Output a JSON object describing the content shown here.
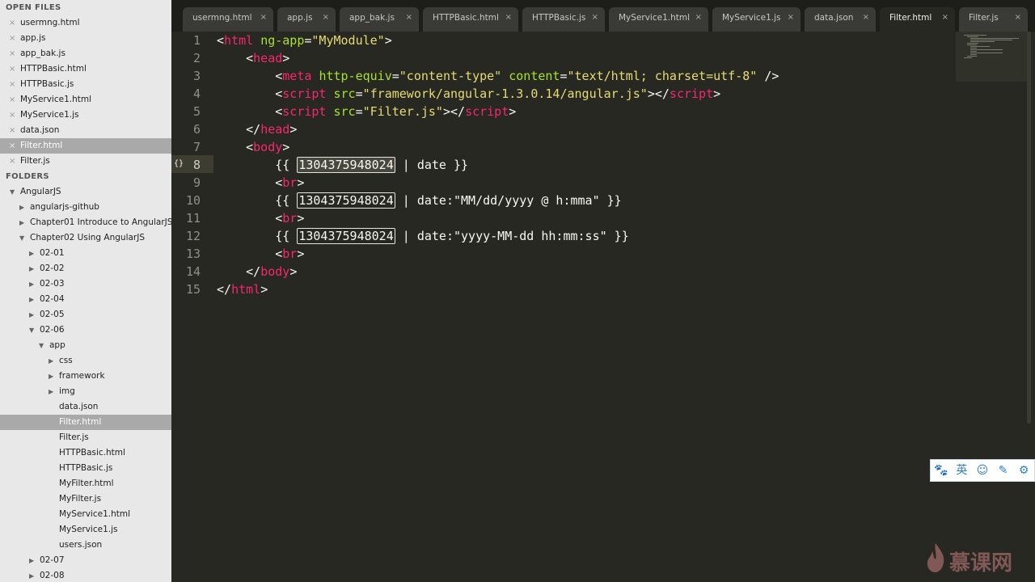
{
  "sidebar": {
    "open_files_header": "OPEN FILES",
    "open_files": [
      {
        "label": "usermng.html",
        "selected": false
      },
      {
        "label": "app.js",
        "selected": false
      },
      {
        "label": "app_bak.js",
        "selected": false
      },
      {
        "label": "HTTPBasic.html",
        "selected": false
      },
      {
        "label": "HTTPBasic.js",
        "selected": false
      },
      {
        "label": "MyService1.html",
        "selected": false
      },
      {
        "label": "MyService1.js",
        "selected": false
      },
      {
        "label": "data.json",
        "selected": false
      },
      {
        "label": "Filter.html",
        "selected": true
      },
      {
        "label": "Filter.js",
        "selected": false
      }
    ],
    "folders_header": "FOLDERS",
    "tree": [
      {
        "label": "AngularJS",
        "depth": 0,
        "type": "folder",
        "open": true
      },
      {
        "label": "angularjs-github",
        "depth": 1,
        "type": "folder",
        "open": false
      },
      {
        "label": "Chapter01 Introduce to AngularJS",
        "depth": 1,
        "type": "folder",
        "open": false
      },
      {
        "label": "Chapter02 Using AngularJS",
        "depth": 1,
        "type": "folder",
        "open": true
      },
      {
        "label": "02-01",
        "depth": 2,
        "type": "folder",
        "open": false
      },
      {
        "label": "02-02",
        "depth": 2,
        "type": "folder",
        "open": false
      },
      {
        "label": "02-03",
        "depth": 2,
        "type": "folder",
        "open": false
      },
      {
        "label": "02-04",
        "depth": 2,
        "type": "folder",
        "open": false
      },
      {
        "label": "02-05",
        "depth": 2,
        "type": "folder",
        "open": false
      },
      {
        "label": "02-06",
        "depth": 2,
        "type": "folder",
        "open": true
      },
      {
        "label": "app",
        "depth": 3,
        "type": "folder",
        "open": true
      },
      {
        "label": "css",
        "depth": 4,
        "type": "folder",
        "open": false
      },
      {
        "label": "framework",
        "depth": 4,
        "type": "folder",
        "open": false
      },
      {
        "label": "img",
        "depth": 4,
        "type": "folder",
        "open": false
      },
      {
        "label": "data.json",
        "depth": 4,
        "type": "file"
      },
      {
        "label": "Filter.html",
        "depth": 4,
        "type": "file",
        "selected": true
      },
      {
        "label": "Filter.js",
        "depth": 4,
        "type": "file"
      },
      {
        "label": "HTTPBasic.html",
        "depth": 4,
        "type": "file"
      },
      {
        "label": "HTTPBasic.js",
        "depth": 4,
        "type": "file"
      },
      {
        "label": "MyFilter.html",
        "depth": 4,
        "type": "file"
      },
      {
        "label": "MyFilter.js",
        "depth": 4,
        "type": "file"
      },
      {
        "label": "MyService1.html",
        "depth": 4,
        "type": "file"
      },
      {
        "label": "MyService1.js",
        "depth": 4,
        "type": "file"
      },
      {
        "label": "users.json",
        "depth": 4,
        "type": "file"
      },
      {
        "label": "02-07",
        "depth": 2,
        "type": "folder",
        "open": false
      },
      {
        "label": "02-08",
        "depth": 2,
        "type": "folder",
        "open": false
      }
    ]
  },
  "tabs": [
    {
      "label": "usermng.html",
      "active": false
    },
    {
      "label": "app.js",
      "active": false
    },
    {
      "label": "app_bak.js",
      "active": false
    },
    {
      "label": "HTTPBasic.html",
      "active": false
    },
    {
      "label": "HTTPBasic.js",
      "active": false
    },
    {
      "label": "MyService1.html",
      "active": false
    },
    {
      "label": "MyService1.js",
      "active": false
    },
    {
      "label": "data.json",
      "active": false
    },
    {
      "label": "Filter.html",
      "active": true
    },
    {
      "label": "Filter.js",
      "active": false
    }
  ],
  "tab_close_glyph": "×",
  "close_glyph": "×",
  "editor": {
    "current_line": 8,
    "fold_marker": "{}",
    "line_numbers": [
      "1",
      "2",
      "3",
      "4",
      "5",
      "6",
      "7",
      "8",
      "9",
      "10",
      "11",
      "12",
      "13",
      "14",
      "15"
    ],
    "lines": [
      [
        {
          "t": "<"
        },
        {
          "t": "html",
          "c": "tag"
        },
        {
          "t": " "
        },
        {
          "t": "ng-app",
          "c": "attr"
        },
        {
          "t": "="
        },
        {
          "t": "\"MyModule\"",
          "c": "str"
        },
        {
          "t": ">"
        }
      ],
      [
        {
          "t": "    <"
        },
        {
          "t": "head",
          "c": "tag"
        },
        {
          "t": ">"
        }
      ],
      [
        {
          "t": "        <"
        },
        {
          "t": "meta",
          "c": "tag"
        },
        {
          "t": " "
        },
        {
          "t": "http-equiv",
          "c": "attr"
        },
        {
          "t": "="
        },
        {
          "t": "\"content-type\"",
          "c": "str"
        },
        {
          "t": " "
        },
        {
          "t": "content",
          "c": "attr"
        },
        {
          "t": "="
        },
        {
          "t": "\"text/html; charset=utf-8\"",
          "c": "str"
        },
        {
          "t": " />"
        }
      ],
      [
        {
          "t": "        <"
        },
        {
          "t": "script",
          "c": "tag"
        },
        {
          "t": " "
        },
        {
          "t": "src",
          "c": "attr"
        },
        {
          "t": "="
        },
        {
          "t": "\"framework/angular-1.3.0.14/angular.js\"",
          "c": "str"
        },
        {
          "t": "></"
        },
        {
          "t": "script",
          "c": "tag"
        },
        {
          "t": ">"
        }
      ],
      [
        {
          "t": "        <"
        },
        {
          "t": "script",
          "c": "tag"
        },
        {
          "t": " "
        },
        {
          "t": "src",
          "c": "attr"
        },
        {
          "t": "="
        },
        {
          "t": "\"Filter.js\"",
          "c": "str"
        },
        {
          "t": "></"
        },
        {
          "t": "script",
          "c": "tag"
        },
        {
          "t": ">"
        }
      ],
      [
        {
          "t": "    </"
        },
        {
          "t": "head",
          "c": "tag"
        },
        {
          "t": ">"
        }
      ],
      [
        {
          "t": "    <"
        },
        {
          "t": "body",
          "c": "tag"
        },
        {
          "t": ">"
        }
      ],
      [
        {
          "t": "        {{ "
        },
        {
          "t": "1304375948024",
          "c": "num-box num-sel"
        },
        {
          "t": " | date }}"
        }
      ],
      [
        {
          "t": "        <"
        },
        {
          "t": "br",
          "c": "tag"
        },
        {
          "t": ">"
        }
      ],
      [
        {
          "t": "        {{ "
        },
        {
          "t": "1304375948024",
          "c": "num-box"
        },
        {
          "t": " | date:\"MM/dd/yyyy @ h:mma\" }}"
        }
      ],
      [
        {
          "t": "        <"
        },
        {
          "t": "br",
          "c": "tag"
        },
        {
          "t": ">"
        }
      ],
      [
        {
          "t": "        {{ "
        },
        {
          "t": "1304375948024",
          "c": "num-box"
        },
        {
          "t": " | date:\"yyyy-MM-dd hh:mm:ss\" }}"
        }
      ],
      [
        {
          "t": "        <"
        },
        {
          "t": "br",
          "c": "tag"
        },
        {
          "t": ">"
        }
      ],
      [
        {
          "t": "    </"
        },
        {
          "t": "body",
          "c": "tag"
        },
        {
          "t": ">"
        }
      ],
      [
        {
          "t": "</"
        },
        {
          "t": "html",
          "c": "tag"
        },
        {
          "t": ">"
        }
      ]
    ]
  },
  "ime_toolbar": {
    "buttons": [
      {
        "name": "paw-icon",
        "glyph": "🐾"
      },
      {
        "name": "lang-toggle",
        "glyph": "英"
      },
      {
        "name": "emoji-icon",
        "glyph": "☺"
      },
      {
        "name": "pen-icon",
        "glyph": "✎"
      },
      {
        "name": "gear-icon",
        "glyph": "⚙"
      }
    ]
  },
  "watermark": {
    "text": "慕课网"
  },
  "colors": {
    "tag": "#f92672",
    "attr": "#a6e22e",
    "string": "#e6db74",
    "background": "#272822"
  }
}
